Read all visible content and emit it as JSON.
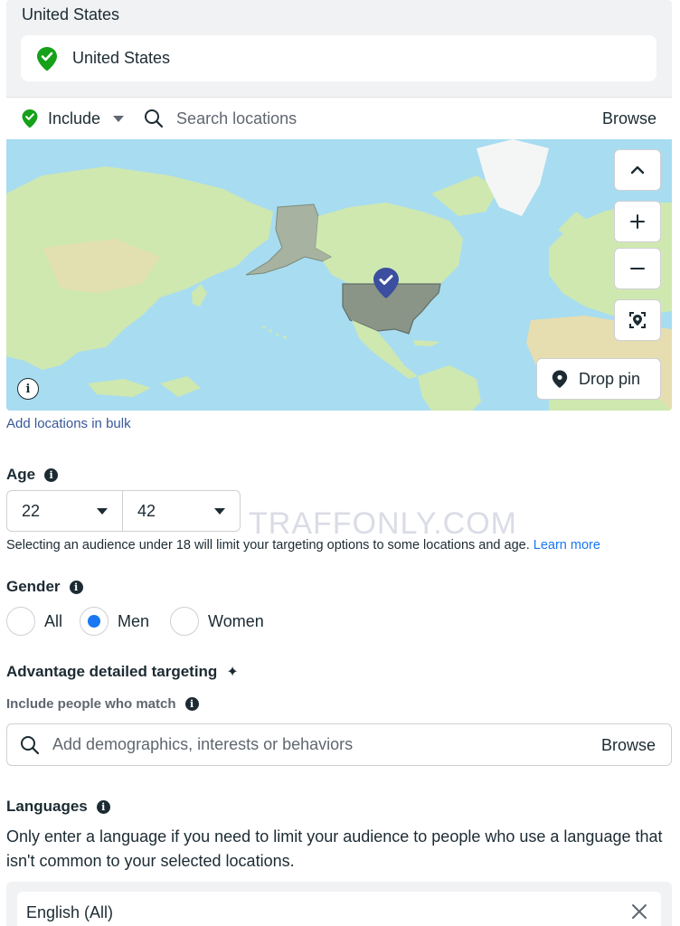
{
  "locations": {
    "country_heading": "United States",
    "selected_location": "United States",
    "include_label": "Include",
    "search_placeholder": "Search locations",
    "browse_label": "Browse",
    "drop_pin_label": "Drop pin",
    "info_glyph": "i",
    "bulk_link": "Add locations in bulk"
  },
  "age": {
    "title": "Age",
    "min": "22",
    "max": "42",
    "note": "Selecting an audience under 18 will limit your targeting options to some locations and age.",
    "learn_more": "Learn more"
  },
  "watermark": "TRAFFONLY.COM",
  "gender": {
    "title": "Gender",
    "options": [
      "All",
      "Men",
      "Women"
    ],
    "selected": "Men"
  },
  "detailed_targeting": {
    "title": "Advantage detailed targeting",
    "sparkle": "✦",
    "sub_label": "Include people who match",
    "placeholder": "Add demographics, interests or behaviors",
    "browse_label": "Browse"
  },
  "languages": {
    "title": "Languages",
    "description": "Only enter a language if you need to limit your audience to people who use a language that isn't common to your selected locations.",
    "selected": "English (All)"
  },
  "colors": {
    "accent": "#1877f2",
    "link": "#385898",
    "pin_green": "#15a11a",
    "map_ocean": "#a8dcf0",
    "map_land": "#cfe8b0",
    "highlight_country": "#8a9588",
    "map_pin": "#3b4ea0"
  },
  "icons": [
    "green-pin-icon",
    "caret-down-icon",
    "search-icon",
    "chevron-up-icon",
    "zoom-in-icon",
    "zoom-out-icon",
    "locate-icon",
    "map-pin-icon",
    "info-icon",
    "close-icon",
    "sparkle-icon"
  ]
}
